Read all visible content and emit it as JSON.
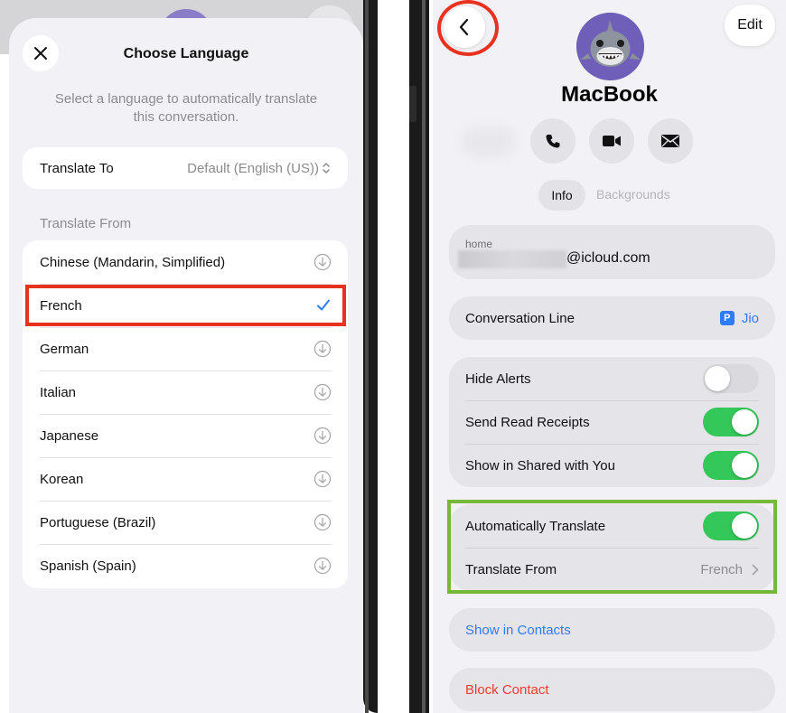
{
  "colors": {
    "accent_blue": "#2f7cf6",
    "toggle_on": "#34c759",
    "destructive": "#ef3b2f",
    "highlight_red": "#e8321f",
    "highlight_green": "#77b83a"
  },
  "left_screen": {
    "title": "Choose Language",
    "subtitle": "Select a language to automatically translate this conversation.",
    "translate_to": {
      "label": "Translate To",
      "value": "Default (English (US))"
    },
    "section_label": "Translate From",
    "languages": [
      {
        "name": "Chinese (Mandarin, Simplified)",
        "icon": "download-icon"
      },
      {
        "name": "French",
        "icon": "checkmark-icon",
        "selected": true
      },
      {
        "name": "German",
        "icon": "download-icon"
      },
      {
        "name": "Italian",
        "icon": "download-icon"
      },
      {
        "name": "Japanese",
        "icon": "download-icon"
      },
      {
        "name": "Korean",
        "icon": "download-icon"
      },
      {
        "name": "Portuguese (Brazil)",
        "icon": "download-icon"
      },
      {
        "name": "Spanish (Spain)",
        "icon": "download-icon"
      }
    ]
  },
  "right_screen": {
    "edit_label": "Edit",
    "contact_name": "MacBook",
    "actions": [
      "phone-icon",
      "video-icon",
      "mail-icon"
    ],
    "segments": {
      "info": "Info",
      "backgrounds": "Backgrounds"
    },
    "email": {
      "label": "home",
      "domain": "@icloud.com"
    },
    "conversation_line": {
      "label": "Conversation Line",
      "badge": "P",
      "value": "Jio"
    },
    "toggles": [
      {
        "label": "Hide Alerts",
        "on": false
      },
      {
        "label": "Send Read Receipts",
        "on": true
      },
      {
        "label": "Show in Shared with You",
        "on": true
      }
    ],
    "auto_translate": {
      "label": "Automatically Translate",
      "on": true
    },
    "translate_from": {
      "label": "Translate From",
      "value": "French"
    },
    "show_in_contacts": "Show in Contacts",
    "block_contact": "Block Contact"
  }
}
